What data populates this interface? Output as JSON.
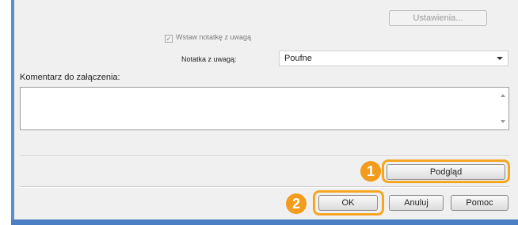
{
  "top_settings_button": "Ustawienia...",
  "insert_note": {
    "label": "Wstaw notatkę z uwagą",
    "checked": true
  },
  "note_field": {
    "label": "Notatka z uwagą:",
    "value": "Poufne"
  },
  "comment": {
    "label": "Komentarz do załączenia:",
    "value": ""
  },
  "preview_button": "Podgląd",
  "footer_buttons": {
    "ok": "OK",
    "cancel": "Anuluj",
    "help": "Pomoc"
  },
  "callouts": {
    "first": "1",
    "second": "2"
  },
  "colors": {
    "highlight": "#f5a623",
    "badge": "#f39b1c",
    "frame": "#5b8fcf"
  }
}
